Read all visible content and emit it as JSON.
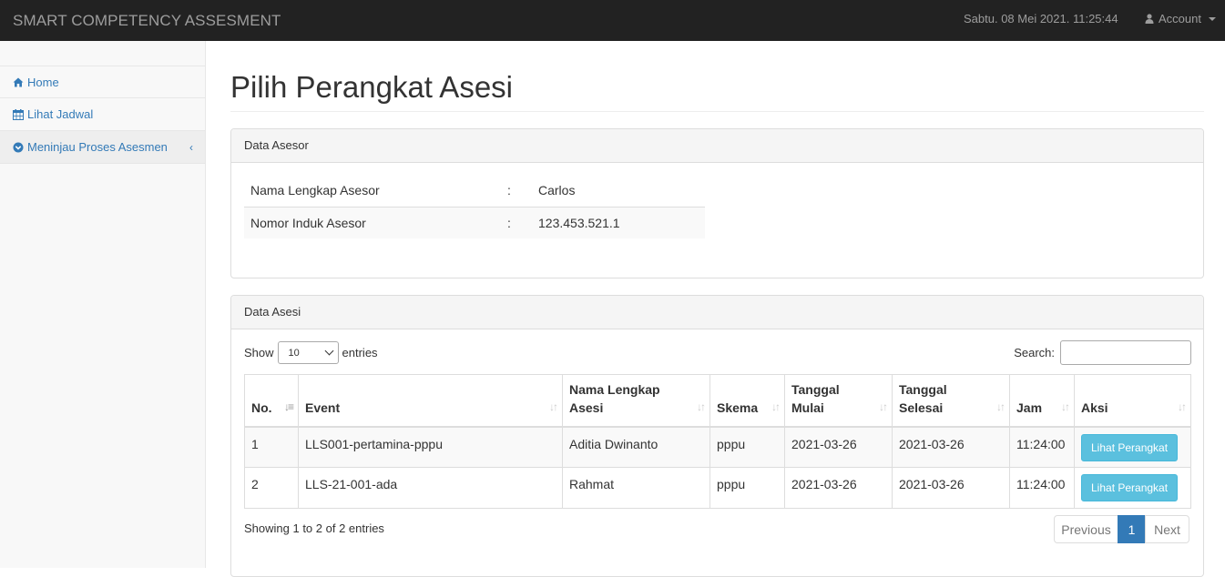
{
  "app": {
    "brand": "SMART COMPETENCY ASSESMENT",
    "datetime": "Sabtu. 08 Mei 2021. 11:25:44",
    "account_label": "Account"
  },
  "sidebar": {
    "items": [
      {
        "label": "Home",
        "icon": "home-icon"
      },
      {
        "label": "Lihat Jadwal",
        "icon": "calendar-icon"
      },
      {
        "label": "Meninjau Proses Asesmen",
        "icon": "chevron-circle-icon"
      }
    ]
  },
  "page": {
    "title": "Pilih Perangkat Asesi"
  },
  "asesor_panel": {
    "heading": "Data Asesor",
    "rows": [
      {
        "label": "Nama Lengkap Asesor",
        "sep": ":",
        "value": "Carlos"
      },
      {
        "label": "Nomor Induk Asesor",
        "sep": ":",
        "value": "123.453.521.1"
      }
    ]
  },
  "asesi_panel": {
    "heading": "Data Asesi",
    "show_label": "Show",
    "entries_value": "10",
    "entries_label": "entries",
    "search_label": "Search:",
    "search_value": "",
    "columns": [
      "No.",
      "Event",
      "Nama Lengkap Asesi",
      "Skema",
      "Tanggal Mulai",
      "Tanggal Selesai",
      "Jam",
      "Aksi"
    ],
    "rows": [
      {
        "no": "1",
        "event": "LLS001-pertamina-pppu",
        "nama": "Aditia Dwinanto",
        "skema": "pppu",
        "mulai": "2021-03-26",
        "selesai": "2021-03-26",
        "jam": "11:24:00",
        "aksi": "Lihat Perangkat"
      },
      {
        "no": "2",
        "event": "LLS-21-001-ada",
        "nama": "Rahmat",
        "skema": "pppu",
        "mulai": "2021-03-26",
        "selesai": "2021-03-26",
        "jam": "11:24:00",
        "aksi": "Lihat Perangkat"
      }
    ],
    "info": "Showing 1 to 2 of 2 entries",
    "pagination": {
      "previous": "Previous",
      "current": "1",
      "next": "Next"
    }
  },
  "colors": {
    "navbar": "#222222",
    "link": "#337ab7",
    "button_info": "#5bc0de",
    "page_active": "#337ab7"
  }
}
